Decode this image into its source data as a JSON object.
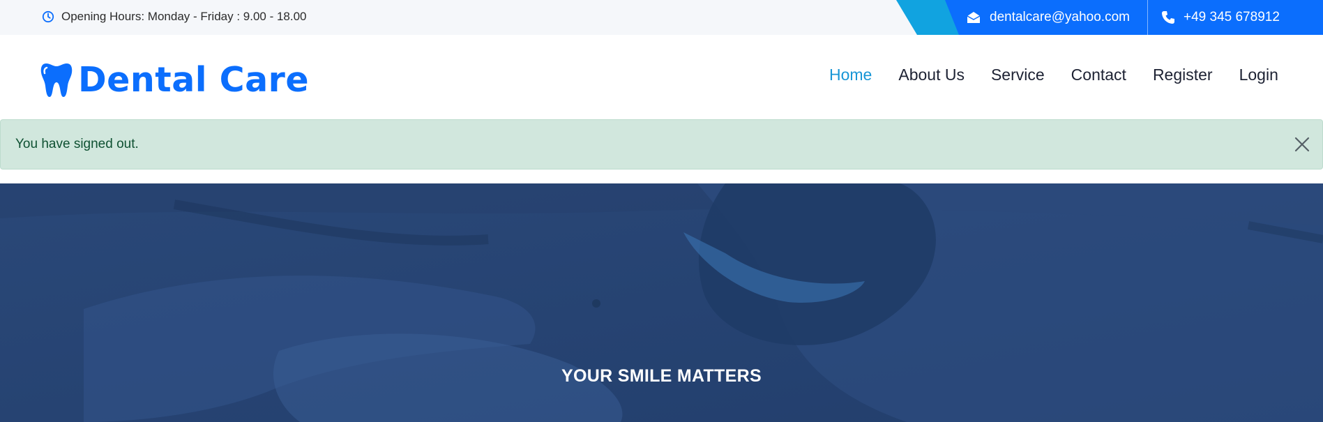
{
  "topbar": {
    "hours_text": "Opening Hours: Monday - Friday : 9.00 - 18.00",
    "email": "dentalcare@yahoo.com",
    "phone": "+49 345 678912"
  },
  "brand": {
    "name": "Dental Care",
    "icon": "tooth-icon",
    "color": "#0b6efd"
  },
  "nav": {
    "items": [
      {
        "label": "Home",
        "active": true
      },
      {
        "label": "About Us",
        "active": false
      },
      {
        "label": "Service",
        "active": false
      },
      {
        "label": "Contact",
        "active": false
      },
      {
        "label": "Register",
        "active": false
      },
      {
        "label": "Login",
        "active": false
      }
    ]
  },
  "alert": {
    "message": "You have signed out.",
    "close_icon": "close-icon",
    "background": "#d1e7dd"
  },
  "hero": {
    "kicker": "YOUR SMILE MATTERS",
    "overlay_color": "#2c4a7a"
  }
}
